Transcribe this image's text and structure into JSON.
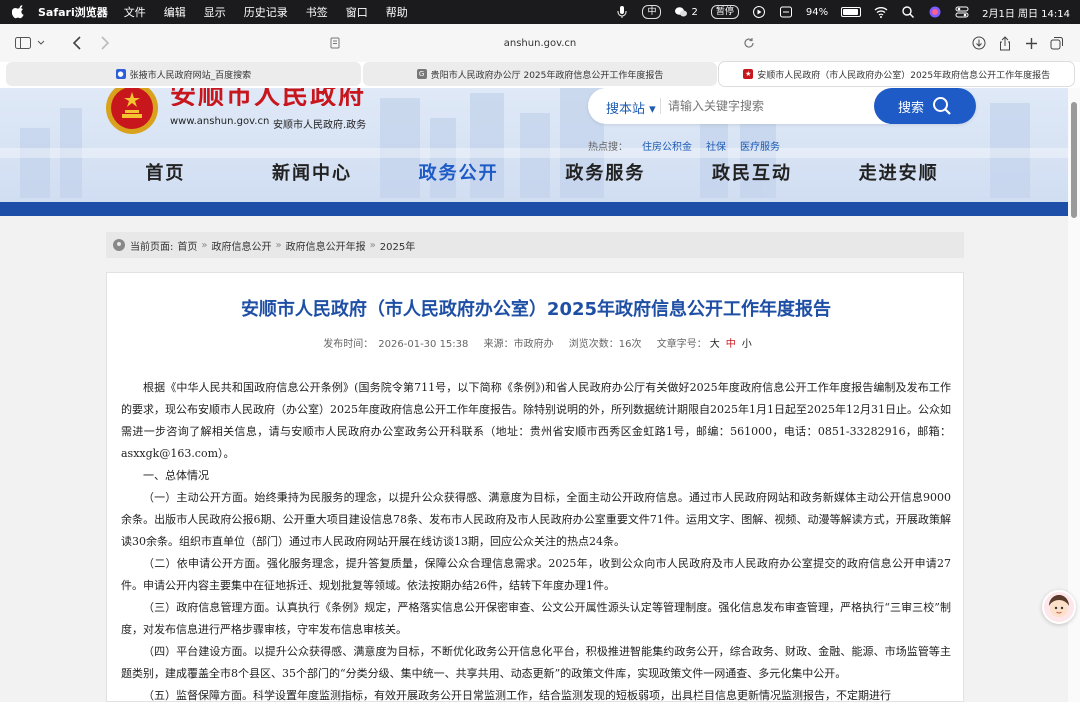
{
  "menubar": {
    "app_name": "Safari浏览器",
    "menus": [
      "文件",
      "编辑",
      "显示",
      "历史记录",
      "书签",
      "窗口",
      "帮助"
    ],
    "wechat_count": "2",
    "recording_label": "暂停",
    "battery": "94%",
    "datetime": "2月1日 周日  14:14"
  },
  "browser": {
    "url": "anshun.gov.cn",
    "tabs": [
      {
        "title": "张掖市人民政府网站_百度搜索",
        "favicon_color": "#2f5fd8"
      },
      {
        "title": "贵阳市人民政府办公厅 2025年政府信息公开工作年度报告",
        "favicon_color": "#777777"
      },
      {
        "title": "安顺市人民政府（市人民政府办公室）2025年政府信息公开工作年度报告",
        "favicon_color": "#c8161d"
      }
    ]
  },
  "site": {
    "title": "安顺市人民政府",
    "url": "www.anshun.gov.cn",
    "subtitle": "安顺市人民政府.政务",
    "search": {
      "scope": "搜本站 ▾",
      "placeholder": "请输入关键字搜索",
      "button": "搜索"
    },
    "hot": {
      "label": "热点搜：",
      "links": [
        "住房公积金",
        "社保",
        "医疗服务"
      ]
    },
    "nav": [
      "首页",
      "新闻中心",
      "政务公开",
      "政务服务",
      "政民互动",
      "走进安顺"
    ],
    "nav_active_index": 2,
    "colors": {
      "brand_red": "#c8161d",
      "brand_blue": "#1e5bc6"
    }
  },
  "breadcrumb": {
    "prefix": "当前页面:",
    "items": [
      "首页",
      "政府信息公开",
      "政府信息公开年报",
      "2025年"
    ]
  },
  "article": {
    "title": "安顺市人民政府（市人民政府办公室）2025年政府信息公开工作年度报告",
    "meta": {
      "publish": "发布时间：　2026-01-30 15:38",
      "source": "来源：市政府办",
      "views": "浏览次数：16次",
      "fontsize_label": "文章字号：",
      "fs_big": "大",
      "fs_mid": "中",
      "fs_small": "小"
    },
    "paragraphs": [
      "根据《中华人民共和国政府信息公开条例》(国务院令第711号，以下简称《条例》)和省人民政府办公厅有关做好2025年度政府信息公开工作年度报告编制及发布工作的要求，现公布安顺市人民政府（办公室）2025年度政府信息公开工作年度报告。除特别说明的外，所列数据统计期限自2025年1月1日起至2025年12月31日止。公众如需进一步咨询了解相关信息，请与安顺市人民政府办公室政务公开科联系（地址：贵州省安顺市西秀区金虹路1号，邮编：561000，电话：0851-33282916，邮箱：asxxgk@163.com）。",
      "一、总体情况",
      "（一）主动公开方面。始终秉持为民服务的理念，以提升公众获得感、满意度为目标，全面主动公开政府信息。通过市人民政府网站和政务新媒体主动公开信息9000余条。出版市人民政府公报6期、公开重大项目建设信息78条、发布市人民政府及市人民政府办公室重要文件71件。运用文字、图解、视频、动漫等解读方式，开展政策解读30余条。组织市直单位（部门）通过市人民政府网站开展在线访谈13期，回应公众关注的热点24条。",
      "（二）依申请公开方面。强化服务理念，提升答复质量，保障公众合理信息需求。2025年，收到公众向市人民政府及市人民政府办公室提交的政府信息公开申请27件。申请公开内容主要集中在征地拆迁、规划批复等领域。依法按期办结26件，结转下年度办理1件。",
      "（三）政府信息管理方面。认真执行《条例》规定，严格落实信息公开保密审查、公文公开属性源头认定等管理制度。强化信息发布审查管理，严格执行“三审三校”制度，对发布信息进行严格步骤审核，守牢发布信息审核关。",
      "（四）平台建设方面。以提升公众获得感、满意度为目标，不断优化政务公开信息化平台，积极推进智能集约政务公开，综合政务、财政、金融、能源、市场监管等主题类别，建成覆盖全市8个县区、35个部门的“分类分级、集中统一、共享共用、动态更新”的政策文件库，实现政策文件一网通查、多元化集中公开。",
      "（五）监督保障方面。科学设置年度监测指标，有效开展政务公开日常监测工作，结合监测发现的短板弱项，出具栏目信息更新情况监测报告，不定期进行"
    ]
  }
}
